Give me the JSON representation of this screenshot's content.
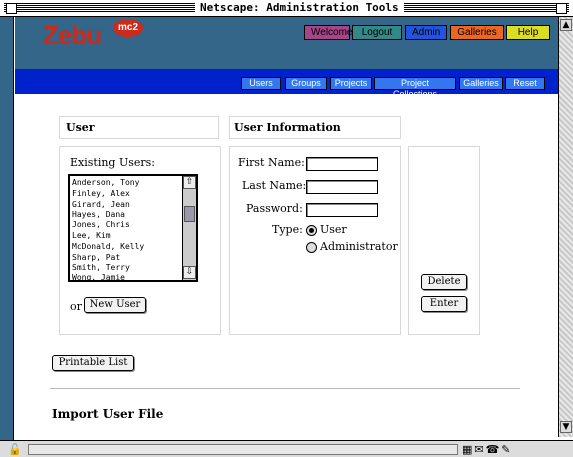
{
  "window": {
    "title": "Netscape: Administration Tools"
  },
  "brand": {
    "logo_text": "Zebu",
    "logo_badge": "mc2"
  },
  "topnav": [
    {
      "label": "Welcome",
      "color": "#aa4488"
    },
    {
      "label": "Logout",
      "color": "#338888"
    },
    {
      "label": "Admin",
      "color": "#2255dd"
    },
    {
      "label": "Galleries",
      "color": "#ee6622"
    },
    {
      "label": "Help",
      "color": "#dddd22"
    }
  ],
  "subnav": [
    "Users",
    "Groups",
    "Projects",
    "Project Collections",
    "Galleries",
    "Reset"
  ],
  "user_section": {
    "heading": "User",
    "existing_label": "Existing Users:",
    "users": [
      "Anderson, Tony",
      "Finley, Alex",
      "Girard, Jean",
      "Hayes, Dana",
      "Jones, Chris",
      "Lee, Kim",
      "McDonald, Kelly",
      "Sharp, Pat",
      "Smith, Terry",
      "Wong, Jamie"
    ],
    "or_label": "or",
    "new_user_button": "New User"
  },
  "info_section": {
    "heading": "User Information",
    "first_name_label": "First Name:",
    "last_name_label": "Last Name:",
    "password_label": "Password:",
    "type_label": "Type:",
    "type_options": [
      {
        "label": "User",
        "selected": true
      },
      {
        "label": "Administrator",
        "selected": false
      }
    ]
  },
  "actions": {
    "delete_button": "Delete",
    "enter_button": "Enter"
  },
  "printable_button": "Printable List",
  "import_heading": "Import User File"
}
